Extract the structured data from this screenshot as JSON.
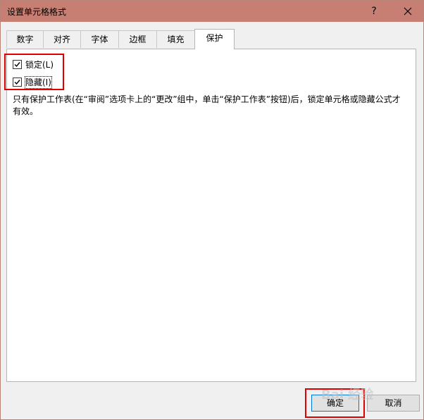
{
  "window": {
    "title": "设置单元格格式",
    "help_label": "?"
  },
  "tabs": [
    {
      "label": "数字"
    },
    {
      "label": "对齐"
    },
    {
      "label": "字体"
    },
    {
      "label": "边框"
    },
    {
      "label": "填充"
    },
    {
      "label": "保护"
    }
  ],
  "active_tab": "保护",
  "protection": {
    "locked_label": "锁定(L)",
    "locked_checked": true,
    "hidden_label": "隐藏(I)",
    "hidden_checked": true,
    "description": "只有保护工作表(在“审阅”选项卡上的“更改”组中，单击“保护工作表”按钮)后，锁定单元格或隐藏公式才有效。"
  },
  "buttons": {
    "ok_label": "确定",
    "cancel_label": "取消"
  },
  "watermark": "Bai 经验",
  "colors": {
    "titlebar": "#c77f73",
    "highlight_box": "#e00000",
    "dialog_bg": "#f0f0f0",
    "panel_bg": "#ffffff"
  }
}
